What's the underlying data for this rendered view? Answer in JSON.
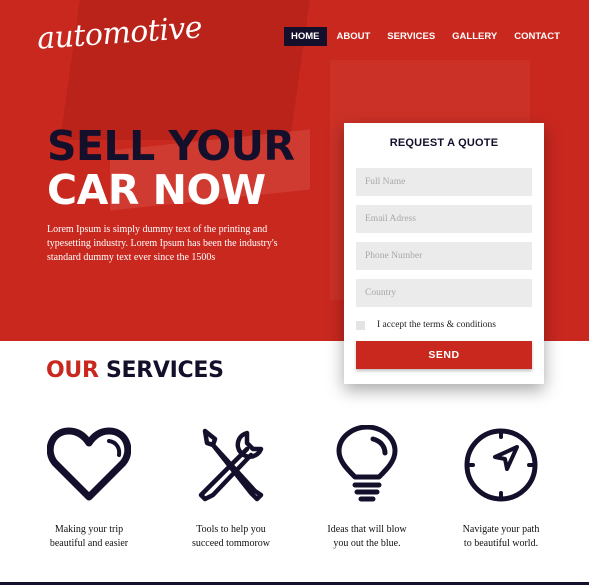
{
  "brand": {
    "logo_text": "automotive"
  },
  "nav": {
    "items": [
      {
        "label": "HOME",
        "active": true
      },
      {
        "label": "ABOUT"
      },
      {
        "label": "SERVICES"
      },
      {
        "label": "GALLERY"
      },
      {
        "label": "CONTACT"
      }
    ]
  },
  "hero": {
    "headline_line1": "SELL YOUR",
    "headline_line2": "CAR NOW",
    "body": "Lorem Ipsum is simply dummy text of the printing and typesetting industry. Lorem Ipsum has been the industry's standard dummy text ever since the 1500s"
  },
  "quote_form": {
    "title": "REQUEST A QUOTE",
    "fields": [
      {
        "placeholder": "Full Name"
      },
      {
        "placeholder": "Email Adress"
      },
      {
        "placeholder": "Phone Number"
      },
      {
        "placeholder": "Country"
      }
    ],
    "terms_label": "I accept the terms & conditions",
    "terms_checked": false,
    "send_label": "SEND"
  },
  "services": {
    "title_accent": "OUR",
    "title_rest": "SERVICES",
    "items": [
      {
        "icon": "heart-icon",
        "caption_line1": "Making your trip",
        "caption_line2": "beautiful and easier"
      },
      {
        "icon": "tools-icon",
        "caption_line1": "Tools to help you",
        "caption_line2": "succeed tommorow"
      },
      {
        "icon": "lightbulb-icon",
        "caption_line1": "Ideas that will blow",
        "caption_line2": "you out the blue."
      },
      {
        "icon": "compass-icon",
        "caption_line1": "Navigate your path",
        "caption_line2": "to beautiful world."
      }
    ]
  },
  "colors": {
    "accent": "#c9281f",
    "dark": "#140f2b",
    "field_bg": "#ebebeb"
  }
}
